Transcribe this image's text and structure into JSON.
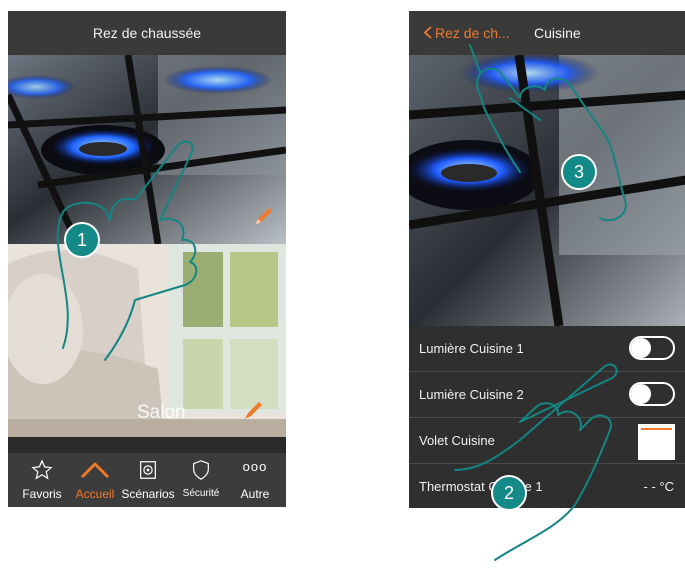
{
  "left_screen": {
    "header_title": "Rez de chaussée",
    "rooms": [
      {
        "label": ""
      },
      {
        "label": "Salon"
      }
    ],
    "tabs": [
      {
        "label": "Favoris",
        "icon": "star-icon"
      },
      {
        "label": "Accueil",
        "icon": "home-icon",
        "active": true
      },
      {
        "label": "Scénarios",
        "icon": "scenarios-icon"
      },
      {
        "label": "Sécurité",
        "icon": "shield-icon"
      },
      {
        "label": "Autre",
        "icon": "more-dots-icon",
        "icon_text": "ooo"
      }
    ]
  },
  "right_screen": {
    "back_label": "Rez de ch...",
    "title": "Cuisine",
    "rows": [
      {
        "label": "Lumière Cuisine 1",
        "control": "toggle",
        "state": "off"
      },
      {
        "label": "Lumière Cuisine 2",
        "control": "toggle",
        "state": "off"
      },
      {
        "label": "Volet Cuisine",
        "control": "shutter"
      },
      {
        "label": "Thermostat Cuisine 1",
        "control": "value",
        "value": "- - °C"
      }
    ]
  },
  "callouts": [
    {
      "number": "1"
    },
    {
      "number": "2"
    },
    {
      "number": "3"
    }
  ],
  "colors": {
    "accent": "#f07a2a",
    "callout": "#148a88",
    "header_bg": "#3a3a3a",
    "list_bg": "#2f2f2f"
  }
}
